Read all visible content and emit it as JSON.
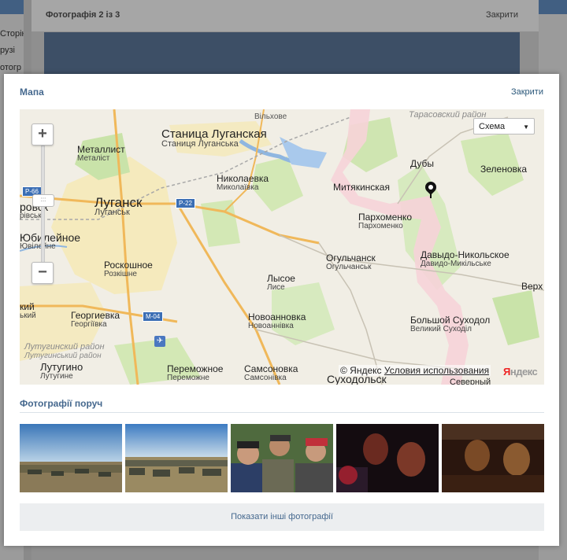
{
  "background": {
    "left_items": [
      "Сторін",
      "рузі",
      "отогр"
    ]
  },
  "viewer": {
    "title": "Фотографія 2 із 3",
    "close": "Закрити"
  },
  "dialog": {
    "title": "Мапа",
    "close": "Закрити",
    "map": {
      "layer_select": "Схема",
      "zoom_in": "+",
      "zoom_out": "−",
      "copyright": "© Яндекс",
      "terms": "Условия использования",
      "logo_y": "Я",
      "logo_rest": "ндекс",
      "road_shields": [
        "Р-66",
        "Р-22",
        "М-04"
      ],
      "labels": {
        "stanitsa": "Станица Луганская",
        "stanitsa_ua": "Станиця Луганська",
        "vilkhove": "Вільхове",
        "tarasovsky": "Тарасовский район",
        "metallist": "Металлист",
        "metallist_ua": "Металіст",
        "nikolaevka": "Николаевка",
        "nikolaevka_ua": "Миколаївка",
        "duby": "Дубы",
        "zelenovka": "Зеленовка",
        "mityakinskaya": "Митякинская",
        "lugansk": "Луганск",
        "lugansk_ua": "Луганськ",
        "rovsk": "ровск",
        "rovsk_ua": "рівськ",
        "yubileynoe": "Юбилейное",
        "yubileynoe_ua": "Ювілейне",
        "parkhomenko": "Пархоменко",
        "parkhomenko_ua": "Пархоменко",
        "ogulchansk": "Огульчанск",
        "ogulchansk_ua": "Огульчанськ",
        "davydo": "Давыдо-Никольское",
        "davydo_ua": "Давидо-Микільське",
        "roskoshnoe": "Роскошное",
        "roskoshnoe_ua": "Розкішне",
        "lysoe": "Лысое",
        "lysoe_ua": "Лисе",
        "verkh": "Верх",
        "kiy": "кий",
        "ky": "ький",
        "georgievka": "Георгиевка",
        "georgievka_ua": "Георгіївка",
        "novoannovka": "Новоанновка",
        "novoannovka_ua": "Новоаннівка",
        "bolshoy": "Большой Суходол",
        "bolshoy_ua": "Великий Суходіл",
        "lutuginsky": "Лутугинский район",
        "lutuginsky_ua": "Лутугинський район",
        "lutugino": "Лутугино",
        "lutugino_ua": "Лутугине",
        "peremozhnoe": "Переможное",
        "peremozhnoe_ua": "Переможне",
        "samsonovka": "Самсоновка",
        "samsonovka_ua": "Самсонівка",
        "sukhodolsk": "Суходольск",
        "severny": "Северный"
      }
    },
    "nearby_title": "Фотографії поруч",
    "show_more": "Показати інші фотографії"
  }
}
